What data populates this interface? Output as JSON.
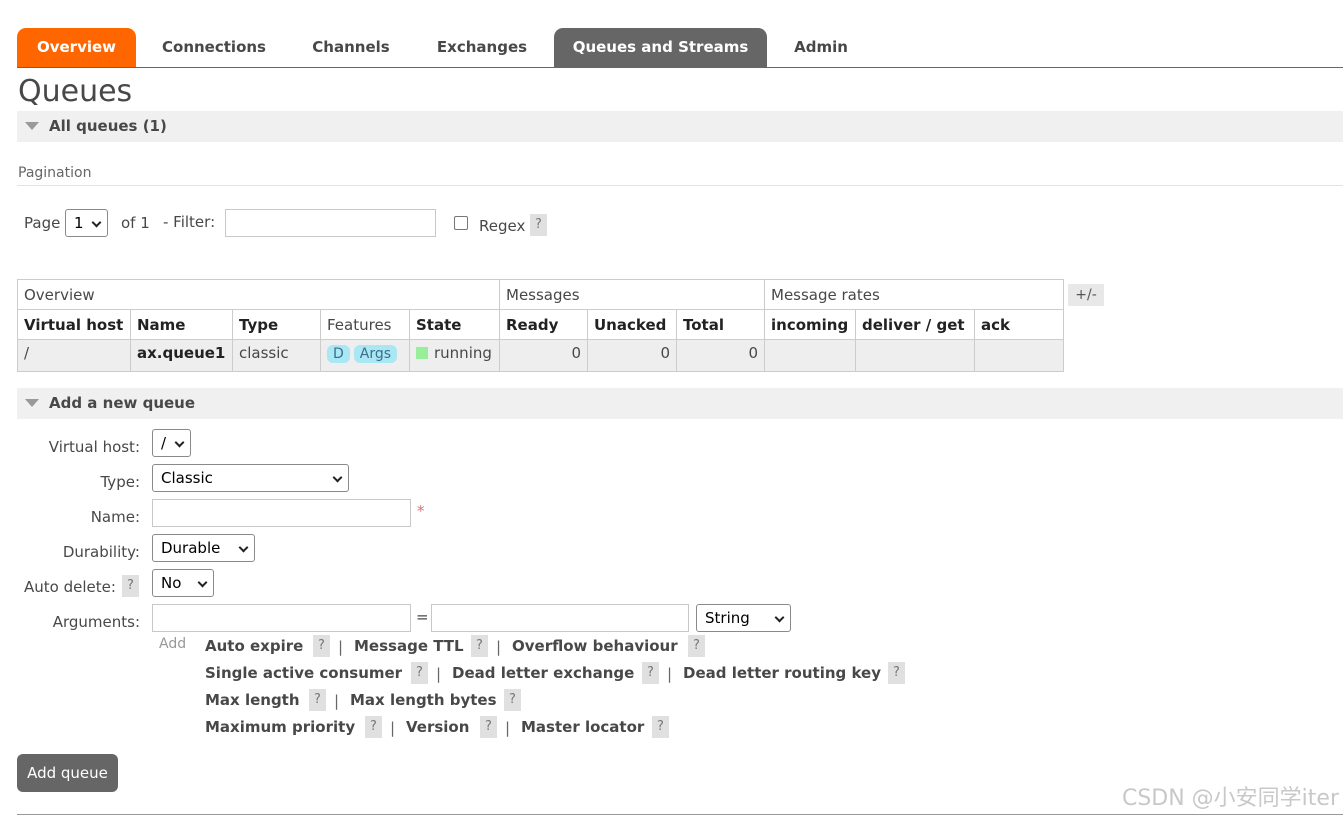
{
  "nav": {
    "tabs": [
      {
        "label": "Overview"
      },
      {
        "label": "Connections"
      },
      {
        "label": "Channels"
      },
      {
        "label": "Exchanges"
      },
      {
        "label": "Queues and Streams"
      },
      {
        "label": "Admin"
      }
    ],
    "colors": {
      "active": "#ff6600",
      "selected": "#666666"
    }
  },
  "page": {
    "title": "Queues"
  },
  "all_queues": {
    "heading": "All queues (1)",
    "pagination_label": "Pagination",
    "page_label": "Page",
    "page_value": "1",
    "of_label": "of 1",
    "filter_label": "- Filter:",
    "filter_value": "",
    "regex_label": "Regex",
    "regex_checked": false,
    "help": "?"
  },
  "table": {
    "groups": [
      "Overview",
      "Messages",
      "Message rates"
    ],
    "columns": [
      "Virtual host",
      "Name",
      "Type",
      "Features",
      "State",
      "Ready",
      "Unacked",
      "Total",
      "incoming",
      "deliver / get",
      "ack"
    ],
    "toggle_label": "+/-",
    "rows": [
      {
        "vhost": "/",
        "name": "ax.queue1",
        "type": "classic",
        "features": [
          "D",
          "Args"
        ],
        "state": "running",
        "ready": "0",
        "unacked": "0",
        "total": "0",
        "incoming": "",
        "deliver_get": "",
        "ack": ""
      }
    ]
  },
  "add_queue": {
    "heading": "Add a new queue",
    "vhost_label": "Virtual host:",
    "vhost_value": "/",
    "type_label": "Type:",
    "type_value": "Classic",
    "name_label": "Name:",
    "name_value": "",
    "required_mark": "*",
    "durability_label": "Durability:",
    "durability_value": "Durable",
    "auto_delete_label": "Auto delete:",
    "auto_delete_value": "No",
    "arguments_label": "Arguments:",
    "arg_key_value": "",
    "equals": "=",
    "arg_value_value": "",
    "arg_type_value": "String",
    "add_label": "Add",
    "separator": "|",
    "presets": [
      "Auto expire",
      "Message TTL",
      "Overflow behaviour",
      "Single active consumer",
      "Dead letter exchange",
      "Dead letter routing key",
      "Max length",
      "Max length bytes",
      "Maximum priority",
      "Version",
      "Master locator"
    ],
    "submit_label": "Add queue"
  },
  "watermark": "CSDN @小安同学iter"
}
